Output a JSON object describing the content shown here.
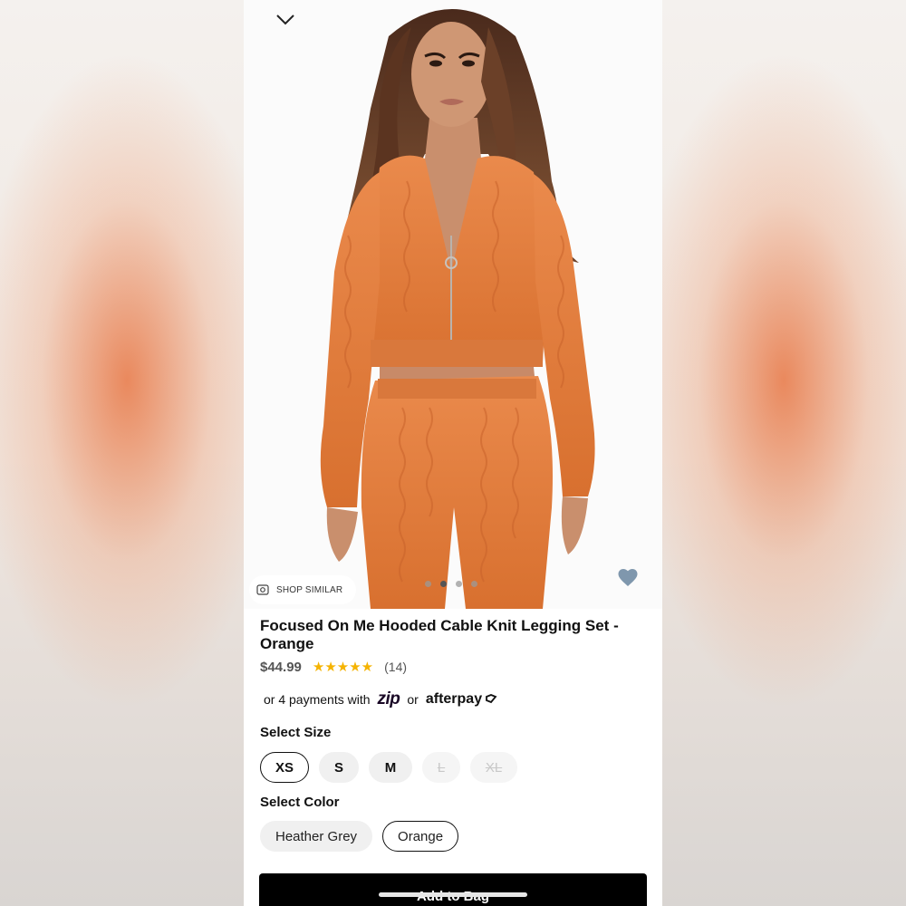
{
  "product": {
    "title": "Focused On Me Hooded Cable Knit Legging Set - Orange",
    "price": "$44.99",
    "stars": "★★★★★",
    "rating": 5,
    "review_count": "(14)"
  },
  "image": {
    "shop_similar_label": "SHOP SIMILAR",
    "carousel_total": 4,
    "carousel_active": 1
  },
  "payments": {
    "prefix": "or 4 payments with",
    "provider1": "zip",
    "separator": "or",
    "provider2": "afterpay"
  },
  "size": {
    "label": "Select Size",
    "options": [
      {
        "label": "XS",
        "state": "selected"
      },
      {
        "label": "S",
        "state": "available"
      },
      {
        "label": "M",
        "state": "available"
      },
      {
        "label": "L",
        "state": "disabled"
      },
      {
        "label": "XL",
        "state": "disabled"
      }
    ]
  },
  "color": {
    "label": "Select Color",
    "options": [
      {
        "label": "Heather Grey",
        "state": "available"
      },
      {
        "label": "Orange",
        "state": "selected"
      }
    ]
  },
  "cta": {
    "add_to_bag": "Add to Bag"
  },
  "colors": {
    "accent_orange": "#e07a3a",
    "favorite_icon": "#7f97ad",
    "star": "#f5b301",
    "zip_purple": "#8a5cf6"
  },
  "icons": [
    "chevron-down-icon",
    "shop-similar-icon",
    "heart-icon",
    "afterpay-loop-icon"
  ]
}
